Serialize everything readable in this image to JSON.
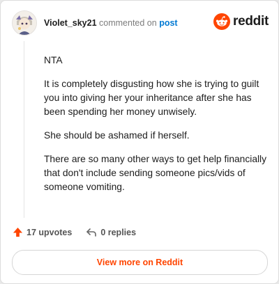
{
  "header": {
    "username": "Violet_sky21",
    "commented_on": "commented on",
    "post_link": "post"
  },
  "brand": {
    "word": "reddit",
    "accent_color": "#ff4500"
  },
  "comment": {
    "paragraphs": [
      "NTA",
      "It is completely disgusting how she is trying to guilt you into giving her your inheritance after she has been spending her money unwisely.",
      "She should be ashamed if herself.",
      "There are so many other ways to get help financially that don't include sending someone pics/vids of someone vomiting."
    ]
  },
  "actions": {
    "upvotes": "17 upvotes",
    "replies": "0 replies"
  },
  "footer": {
    "view_more": "View more on Reddit"
  },
  "icons": {
    "avatar": "user-avatar",
    "brand": "reddit-snoo-icon",
    "upvote": "upvote-arrow-icon",
    "reply": "reply-arrow-icon"
  }
}
